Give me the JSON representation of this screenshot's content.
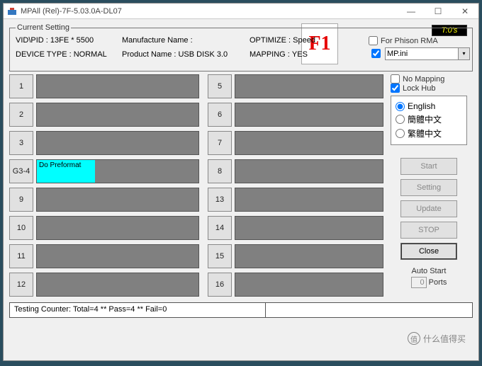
{
  "window": {
    "title": "MPAll (Rel)-7F-5.03.0A-DL07"
  },
  "settings": {
    "legend": "Current Setting",
    "vidpid_k": "VID\\PID : ",
    "vidpid_v": "13FE * 5500",
    "manuf_k": "Manufacture Name : ",
    "manuf_v": "",
    "opt_k": "OPTIMIZE : ",
    "opt_v": "Speed",
    "dev_k": "DEVICE TYPE : ",
    "dev_v": "NORMAL",
    "prod_k": "Product Name : ",
    "prod_v": "USB DISK 3.0",
    "map_k": "MAPPING : ",
    "map_v": "YES",
    "flabel": "F1"
  },
  "top_right": {
    "badge": "T:0's",
    "rma": "For Phison RMA",
    "ini": "MP.ini",
    "nomap": "No Mapping",
    "lockhub": "Lock Hub"
  },
  "lang": {
    "en": "English",
    "cn1": "簡體中文",
    "cn2": "繁體中文"
  },
  "buttons": {
    "start": "Start",
    "setting": "Setting",
    "update": "Update",
    "stop": "STOP",
    "close": "Close"
  },
  "autostart": {
    "label": "Auto Start",
    "value": "0",
    "unit": "Ports"
  },
  "slots_left": [
    "1",
    "2",
    "3",
    "G3-4",
    "9",
    "10",
    "11",
    "12"
  ],
  "slots_right": [
    "5",
    "6",
    "7",
    "8",
    "13",
    "14",
    "15",
    "16"
  ],
  "preformat": "Do Preformat",
  "pref_index": 3,
  "status": "Testing Counter: Total=4 ** Pass=4 ** Fail=0",
  "watermark": "什么值得买"
}
